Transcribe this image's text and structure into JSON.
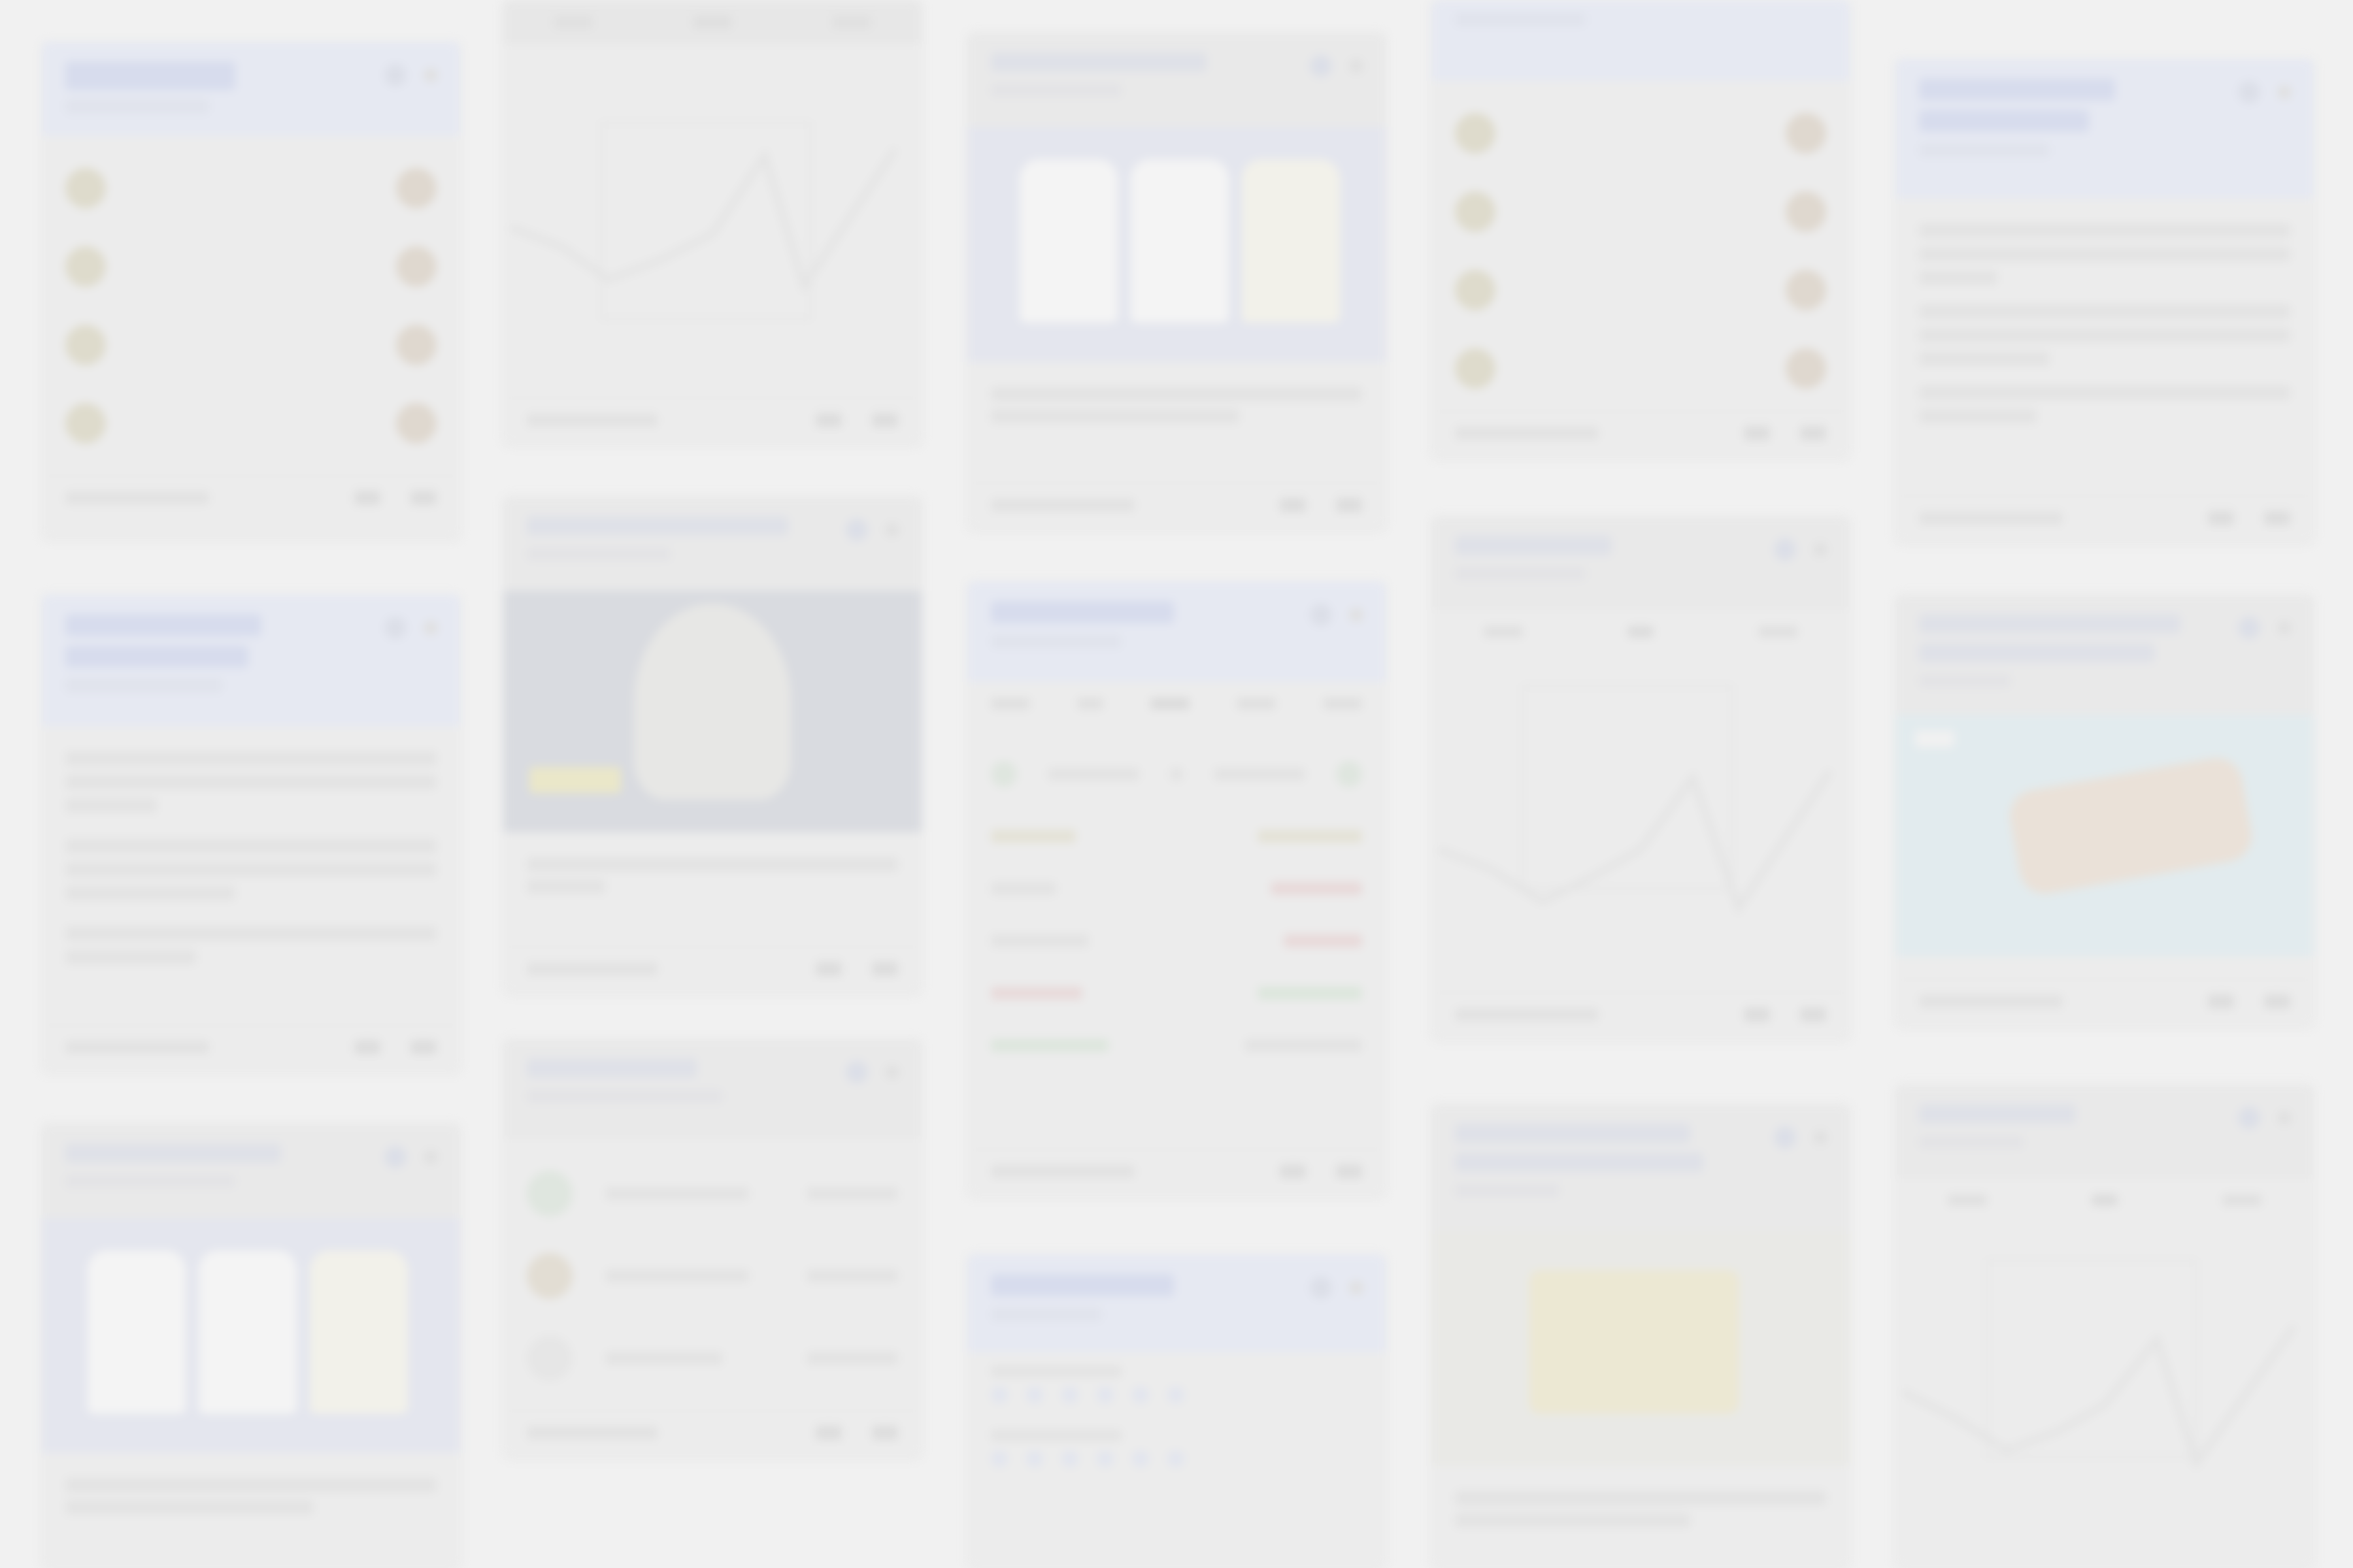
{
  "colors": {
    "background": "#f1f1f1",
    "card": "#ececec",
    "card_header_blue": "#e6e9f2",
    "chart_line": "#e6e6e6"
  },
  "chart_placeholders": [
    {
      "tabs": [
        "",
        "",
        ""
      ]
    },
    {
      "tabs": [
        "",
        "",
        ""
      ]
    },
    {
      "tabs": [
        "",
        "",
        ""
      ]
    }
  ]
}
